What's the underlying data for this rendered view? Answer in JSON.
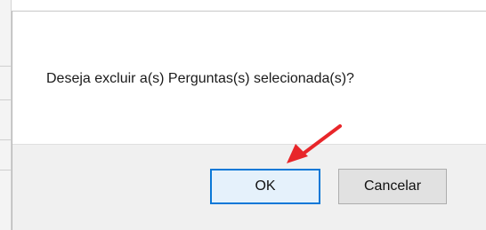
{
  "dialog": {
    "message": "Deseja excluir a(s) Perguntas(s) selecionada(s)?",
    "ok_label": "OK",
    "cancel_label": "Cancelar"
  },
  "annotation": {
    "arrow_color": "#e8262a",
    "points_to": "ok-button"
  },
  "colors": {
    "ok_border": "#0a78d7",
    "ok_fill": "#e5f1fb",
    "footer_bg": "#f0f0f0"
  }
}
